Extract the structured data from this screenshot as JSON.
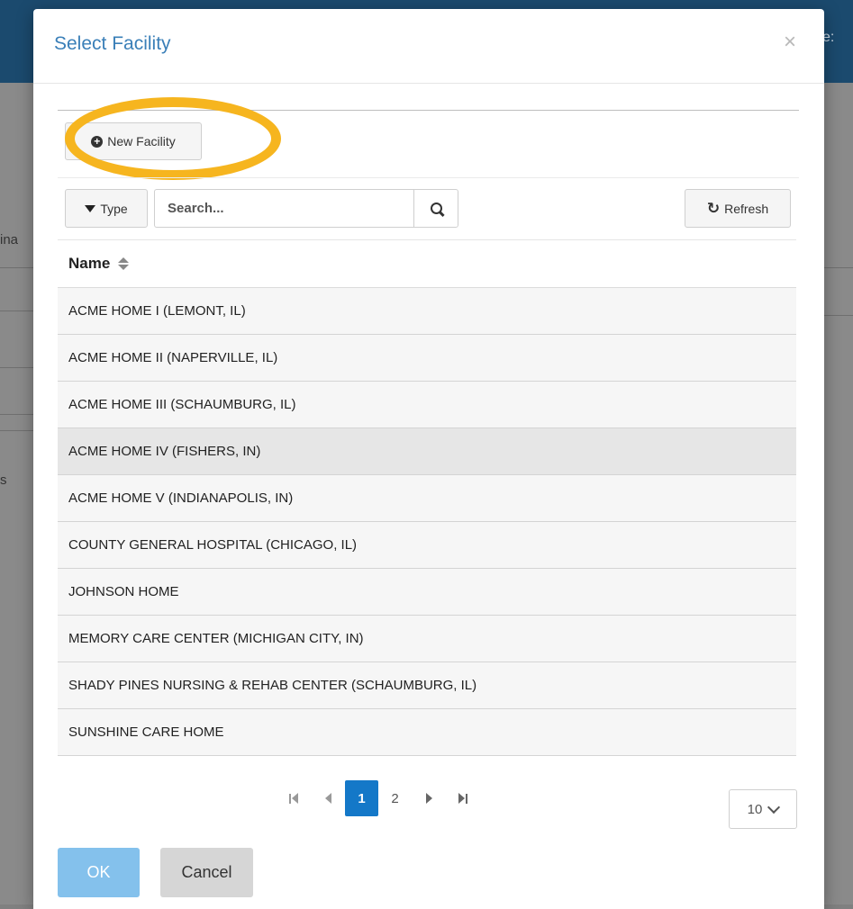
{
  "background": {
    "top_right_fragment": "e:",
    "left_fragment_1": "ina",
    "left_fragment_2": "s"
  },
  "modal": {
    "title": "Select Facility",
    "close_glyph": "×"
  },
  "toolbar": {
    "new_facility_label": "New Facility",
    "type_label": "Type",
    "search_placeholder": "Search...",
    "refresh_label": "Refresh"
  },
  "grid": {
    "column_header": "Name",
    "rows": [
      "ACME HOME I (LEMONT, IL)",
      "ACME HOME II (NAPERVILLE, IL)",
      "ACME HOME III (SCHAUMBURG, IL)",
      "ACME HOME IV (FISHERS, IN)",
      "ACME HOME V (INDIANAPOLIS, IN)",
      "COUNTY GENERAL HOSPITAL (CHICAGO, IL)",
      "JOHNSON HOME",
      "MEMORY CARE CENTER (MICHIGAN CITY, IN)",
      "SHADY PINES NURSING & REHAB CENTER (SCHAUMBURG, IL)",
      "SUNSHINE CARE HOME"
    ],
    "selected_row": "ACME HOME IV (FISHERS, IN)"
  },
  "pager": {
    "pages": [
      "1",
      "2"
    ],
    "current_page": "1",
    "page_size": "10"
  },
  "footer": {
    "ok_label": "OK",
    "cancel_label": "Cancel"
  },
  "colors": {
    "title": "#3a7fb8",
    "active_page": "#1478c8",
    "ok_button": "#84c1ec",
    "highlight_ring": "#f6b51f",
    "app_header": "#1b4a6e"
  }
}
